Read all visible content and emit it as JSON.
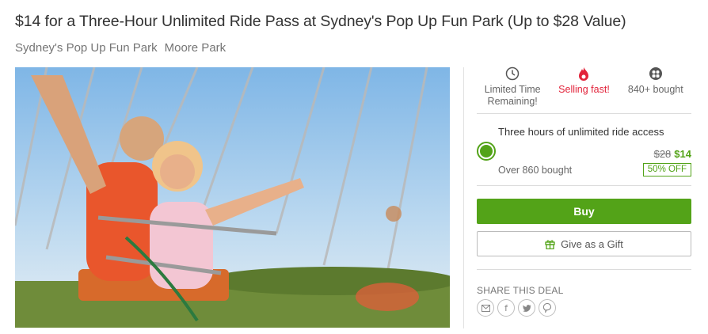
{
  "deal": {
    "title": "$14 for a Three-Hour Unlimited Ride Pass at Sydney's Pop Up Fun Park (Up to $28 Value)",
    "merchant": "Sydney's Pop Up Fun Park",
    "location": "Moore Park"
  },
  "photo": {
    "subject": "swing-ride-photo"
  },
  "stats": [
    {
      "icon": "clock-icon",
      "label": "Limited Time Remaining!"
    },
    {
      "icon": "flame-icon",
      "label": "Selling fast!"
    },
    {
      "icon": "users-icon",
      "label": "840+ bought"
    }
  ],
  "option": {
    "title": "Three hours of unlimited ride access",
    "bought": "Over 860 bought",
    "old_price": "$28",
    "new_price": "$14",
    "discount": "50% OFF",
    "selected": true
  },
  "actions": {
    "buy_label": "Buy",
    "gift_label": "Give as a Gift"
  },
  "share": {
    "label": "SHARE THIS DEAL",
    "icons": [
      "email-icon",
      "facebook-icon",
      "twitter-icon",
      "pinterest-icon"
    ]
  },
  "colors": {
    "accent": "#53a318",
    "alert": "#e2243b"
  }
}
